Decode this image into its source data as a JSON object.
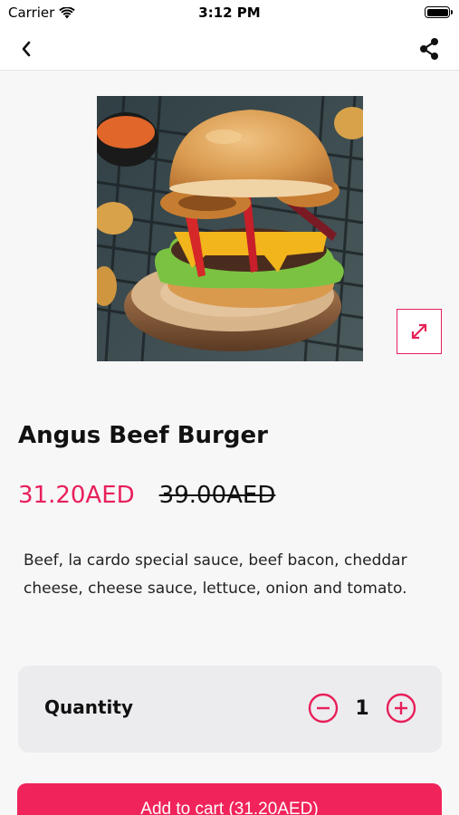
{
  "status_bar": {
    "carrier": "Carrier",
    "time": "3:12 PM"
  },
  "nav": {
    "back_icon": "chevron-left-icon",
    "share_icon": "share-icon"
  },
  "product": {
    "image_name": "burger-photo",
    "expand_icon": "expand-icon",
    "title": "Angus Beef Burger",
    "price_current": "31.20AED",
    "price_old": "39.00AED",
    "description": "Beef, la cardo special sauce, beef bacon, cheddar cheese, cheese sauce, lettuce, onion and tomato."
  },
  "quantity": {
    "label": "Quantity",
    "value": "1",
    "decrement_icon": "minus-circle-icon",
    "increment_icon": "plus-circle-icon"
  },
  "cart": {
    "button_label": "Add to cart (31.20AED)"
  },
  "colors": {
    "accent": "#e8205a",
    "button": "#f0245a",
    "background": "#f7f7f8",
    "card": "#ececef"
  }
}
